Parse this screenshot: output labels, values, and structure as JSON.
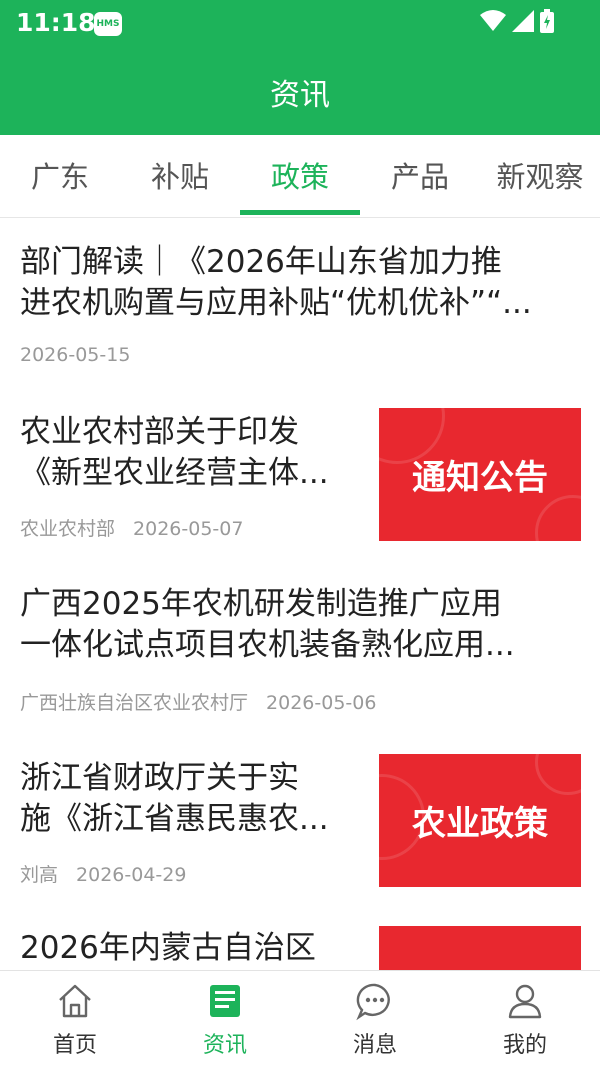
{
  "status_bar": {
    "time": "11:18",
    "badge": "HMS"
  },
  "header": {
    "title": "资讯",
    "bg_color": "#1db35a"
  },
  "tabs": [
    {
      "label": "广东"
    },
    {
      "label": "补贴"
    },
    {
      "label": "政策",
      "active": true
    },
    {
      "label": "产品"
    },
    {
      "label": "新观察"
    }
  ],
  "articles": [
    {
      "title_line1": "部门解读｜《2026年山东省加力推",
      "title_line2": "进农机购置与应用补贴“优机优补”“...",
      "source": "",
      "date": "2026-05-15",
      "thumb_text": ""
    },
    {
      "title_line1": "农业农村部关于印发",
      "title_line2": "《新型农业经营主体...",
      "source": "农业农村部",
      "date": "2026-05-07",
      "thumb_text": "通知公告"
    },
    {
      "title_line1": "广西2025年农机研发制造推广应用",
      "title_line2": "一体化试点项目农机装备熟化应用...",
      "source": "广西壮族自治区农业农村厅",
      "date": "2026-05-06",
      "thumb_text": ""
    },
    {
      "title_line1": "浙江省财政厅关于实",
      "title_line2": "施《浙江省惠民惠农...",
      "source": "刘高",
      "date": "2026-04-29",
      "thumb_text": "农业政策"
    },
    {
      "title_line1": "2026年内蒙古自治区",
      "title_line2": "",
      "source": "",
      "date": "",
      "thumb_text": ""
    }
  ],
  "bottom_nav": [
    {
      "label": "首页",
      "icon": "home-icon"
    },
    {
      "label": "资讯",
      "icon": "news-icon",
      "active": true
    },
    {
      "label": "消息",
      "icon": "message-icon"
    },
    {
      "label": "我的",
      "icon": "profile-icon"
    }
  ],
  "colors": {
    "accent": "#1db35a",
    "thumb_red": "#e8282f"
  }
}
